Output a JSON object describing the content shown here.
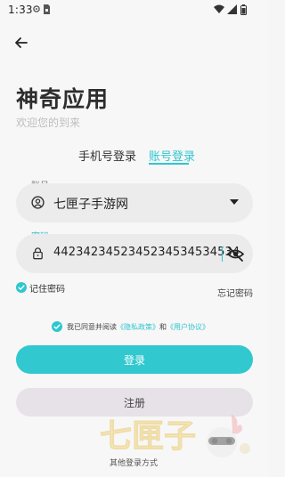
{
  "status_bar": {
    "time": "1:33"
  },
  "header": {
    "title": "神奇应用",
    "subtitle": "欢迎您的到来"
  },
  "tabs": [
    {
      "label": "手机号登录"
    },
    {
      "label": "账号登录"
    }
  ],
  "form": {
    "account_label": "账号",
    "account_value": "七匣子手游网",
    "password_label": "密码",
    "password_value": "44234234523452345345345​34"
  },
  "options": {
    "remember_label": "记住密码",
    "forgot_label": "忘记密码"
  },
  "agreement": {
    "prefix": "我已同意并阅读",
    "privacy_link": "《隐私政策》",
    "and": "和",
    "user_agreement_link": "《用户协议》"
  },
  "buttons": {
    "login": "登录",
    "register": "注册"
  },
  "watermark_text": "七匣子",
  "footer": {
    "other_login": "其他登录方式"
  },
  "colors": {
    "accent": "#2ec6cf",
    "button_login": "#31c8cf",
    "button_register": "#e7e1e8"
  }
}
